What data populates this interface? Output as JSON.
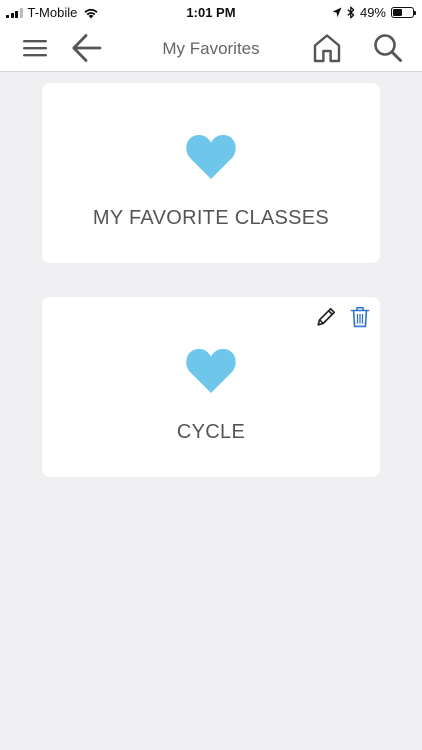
{
  "status_bar": {
    "carrier": "T-Mobile",
    "time": "1:01 PM",
    "battery_percent": "49%",
    "battery_level": 0.49,
    "signal_bars": 3,
    "icons": [
      "signal-icon",
      "wifi-icon",
      "location-arrow-icon",
      "bluetooth-icon",
      "battery-icon"
    ]
  },
  "nav": {
    "title": "My Favorites",
    "icons": [
      "menu-icon",
      "back-arrow-icon",
      "home-icon",
      "search-icon"
    ]
  },
  "favorites": [
    {
      "label": "MY FAVORITE CLASSES",
      "icon": "heart-icon",
      "editable": false
    },
    {
      "label": "CYCLE",
      "icon": "heart-icon",
      "editable": true,
      "actions": [
        "pencil-icon",
        "trash-icon"
      ]
    }
  ],
  "colors": {
    "heart": "#6ec6ea",
    "trash": "#2f73c9",
    "background": "#efeff1",
    "nav_icons": "#555555",
    "label_text": "#555555"
  }
}
